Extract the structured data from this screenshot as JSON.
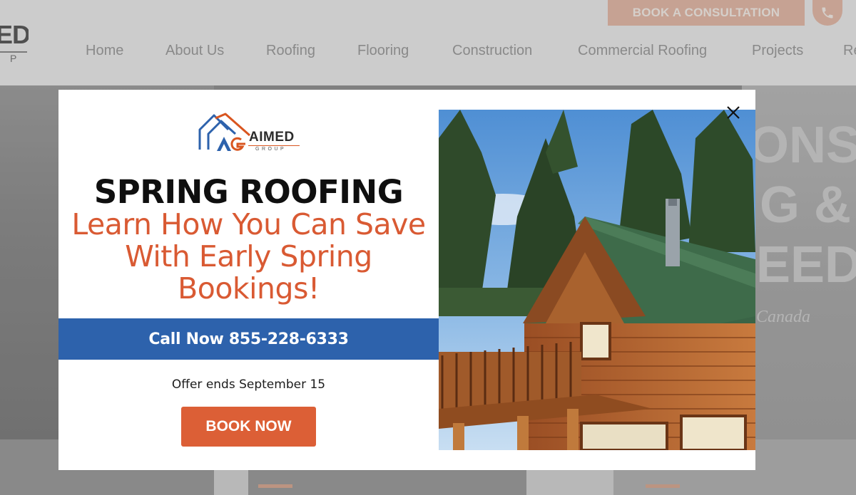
{
  "header": {
    "logo": {
      "text": "ED",
      "sub": "P"
    },
    "consult_label": "BOOK A CONSULTATION",
    "nav": [
      "Home",
      "About Us",
      "Roofing",
      "Flooring",
      "Construction",
      "Commercial Roofing",
      "Projects",
      "Re"
    ]
  },
  "hero": {
    "lines": [
      "ONS F",
      "G &",
      "EEDS"
    ],
    "sub": "Canada"
  },
  "popup": {
    "brand_name": "AIMED",
    "brand_sub": "GROUP",
    "headline": "SPRING ROOFING",
    "subhead": "Learn How You Can Save With Early Spring Bookings!",
    "call_label": "Call Now 855-228-6333",
    "offer": "Offer ends September 15",
    "book_label": "BOOK NOW",
    "image_name": "log-cabin-green-roof-photo"
  },
  "colors": {
    "accent_orange": "#dc5f36",
    "call_blue": "#2d62ac",
    "roof_green": "#3e6b4a"
  }
}
